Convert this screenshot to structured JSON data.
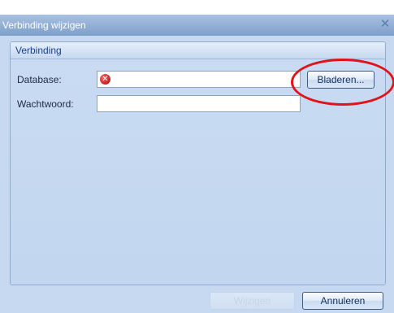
{
  "window": {
    "title": "Verbinding wijzigen",
    "close_icon": "close-icon"
  },
  "group": {
    "title": "Verbinding"
  },
  "database": {
    "label": "Database:",
    "value": "",
    "status_icon": "error-icon"
  },
  "password": {
    "label": "Wachtwoord:",
    "value": ""
  },
  "buttons": {
    "browse": "Bladeren...",
    "ok": "Wijzigen",
    "cancel": "Annuleren"
  },
  "highlight": {
    "color": "#e3121a"
  }
}
